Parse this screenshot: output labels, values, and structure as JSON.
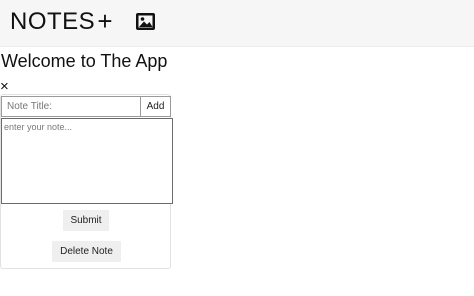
{
  "navbar": {
    "brand": "NOTES",
    "add_icon_glyph": "+",
    "add_icon": "plus-icon",
    "image_icon": "image-icon"
  },
  "main": {
    "heading": "Welcome to The App",
    "close_glyph": "×"
  },
  "form": {
    "title_placeholder": "Note Title:",
    "title_value": "",
    "add_label": "Add",
    "note_placeholder": "enter your note...",
    "note_value": "",
    "submit_label": "Submit",
    "delete_label": "Delete Note"
  }
}
